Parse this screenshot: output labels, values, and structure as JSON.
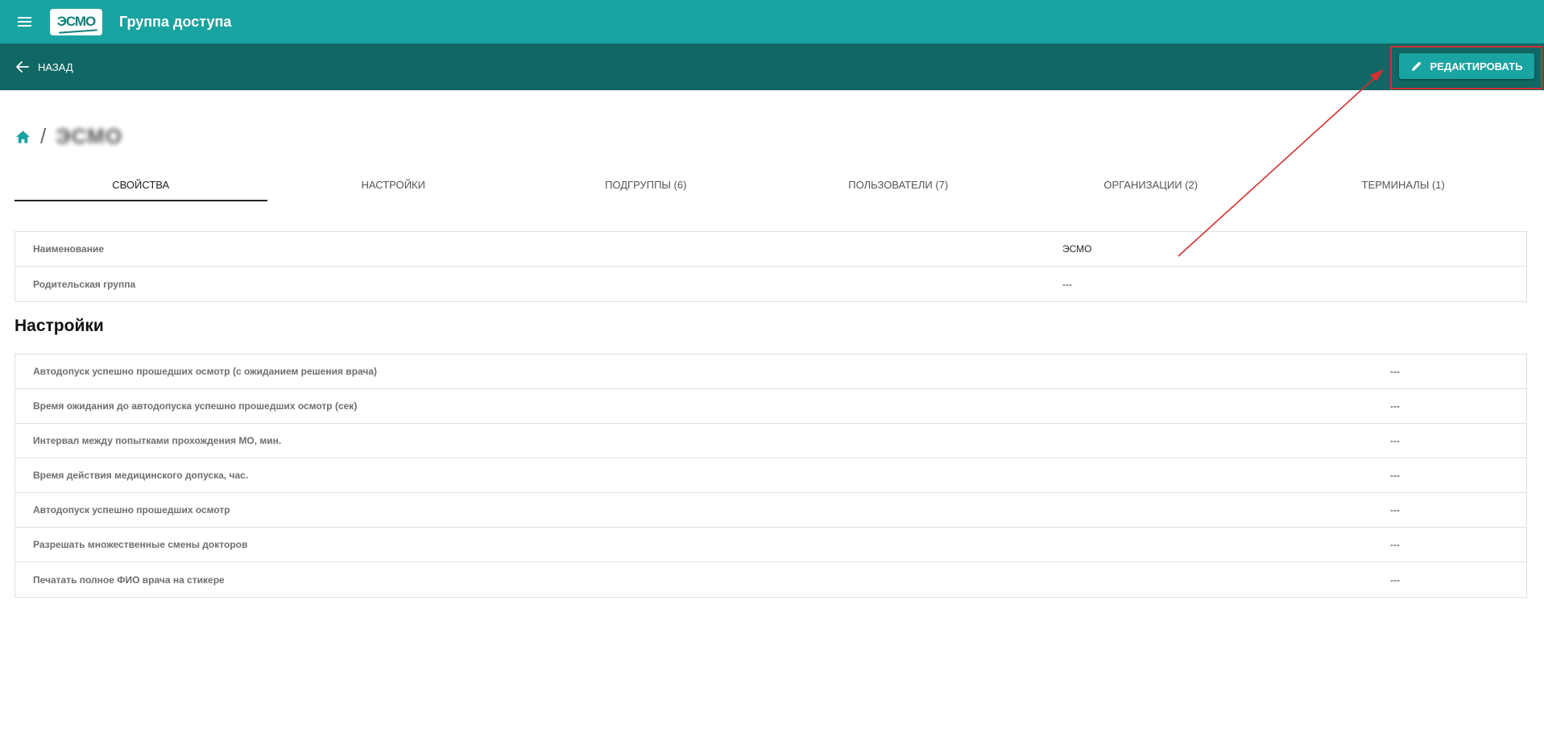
{
  "appbar": {
    "logo_text": "ЭСМО",
    "title": "Группа доступа",
    "menu_icon": "menu-icon"
  },
  "toolbar": {
    "back_label": "НАЗАД",
    "edit_label": "РЕДАКТИРОВАТЬ"
  },
  "breadcrumb": {
    "separator": "/",
    "current": "ЭСМО"
  },
  "tabs": [
    {
      "label": "СВОЙСТВА",
      "active": true
    },
    {
      "label": "НАСТРОЙКИ",
      "active": false
    },
    {
      "label": "ПОДГРУППЫ (6)",
      "active": false
    },
    {
      "label": "ПОЛЬЗОВАТЕЛИ (7)",
      "active": false
    },
    {
      "label": "ОРГАНИЗАЦИИ (2)",
      "active": false
    },
    {
      "label": "ТЕРМИНАЛЫ (1)",
      "active": false
    }
  ],
  "properties": [
    {
      "label": "Наименование",
      "value": "ЭСМО"
    },
    {
      "label": "Родительская группа",
      "value": "---"
    }
  ],
  "settings": {
    "title": "Настройки",
    "rows": [
      {
        "label": "Автодопуск успешно прошедших осмотр (с ожиданием решения врача)",
        "value": "---"
      },
      {
        "label": "Время ожидания до автодопуска успешно прошедших осмотр (сек)",
        "value": "---"
      },
      {
        "label": "Интервал между попытками прохождения МО, мин.",
        "value": "---"
      },
      {
        "label": "Время действия медицинского допуска, час.",
        "value": "---"
      },
      {
        "label": "Автодопуск успешно прошедших осмотр",
        "value": "---"
      },
      {
        "label": "Разрешать множественные смены докторов",
        "value": "---"
      },
      {
        "label": "Печатать полное ФИО врача на стикере",
        "value": "---"
      }
    ]
  },
  "colors": {
    "appbar": "#19a3a1",
    "toolbar": "#116764",
    "accent": "#19a3a1",
    "annotation": "#d32f2f"
  }
}
